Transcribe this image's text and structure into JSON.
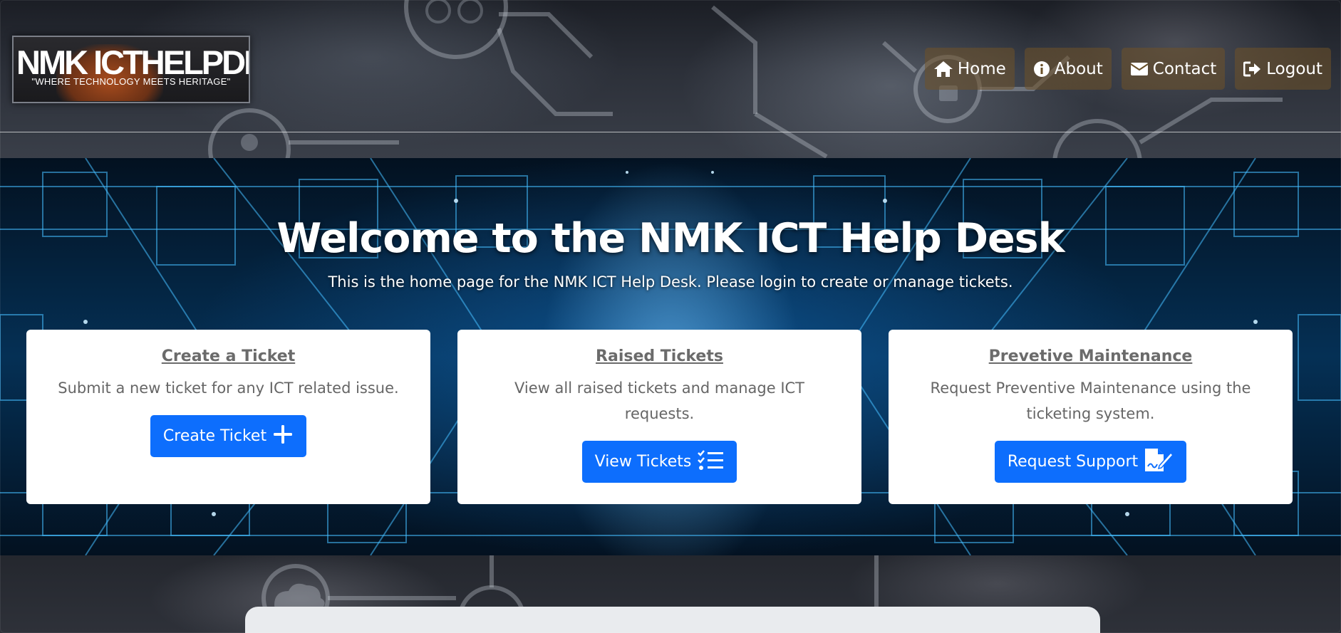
{
  "brand": {
    "logo_title": "NMK ICTHELPDESK",
    "logo_tagline": "\"WHERE TECHNOLOGY MEETS HERITAGE\""
  },
  "nav": {
    "items": [
      {
        "label": "Home",
        "icon": "home-icon"
      },
      {
        "label": "About",
        "icon": "info-circle-icon"
      },
      {
        "label": "Contact",
        "icon": "envelope-icon"
      },
      {
        "label": "Logout",
        "icon": "logout-icon"
      }
    ]
  },
  "hero": {
    "title": "Welcome to the NMK ICT Help Desk",
    "subtitle": "This is the home page for the NMK ICT Help Desk. Please login to create or manage tickets."
  },
  "cards": [
    {
      "title": "Create a Ticket",
      "text": "Submit a new ticket for any ICT related issue.",
      "button": "Create Ticket",
      "button_icon": "plus-icon"
    },
    {
      "title": "Raised Tickets",
      "text": "View all raised tickets and manage ICT requests.",
      "button": "View Tickets",
      "button_icon": "checklist-icon"
    },
    {
      "title": "Prevetive Maintenance",
      "text": "Request Preventive Maintenance using the ticketing system.",
      "button": "Request Support",
      "button_icon": "file-signature-icon"
    }
  ],
  "colors": {
    "primary_button": "#0d6efd",
    "nav_button": "#70522866",
    "card_background": "#ffffff",
    "card_title": "#6b6b6b"
  }
}
